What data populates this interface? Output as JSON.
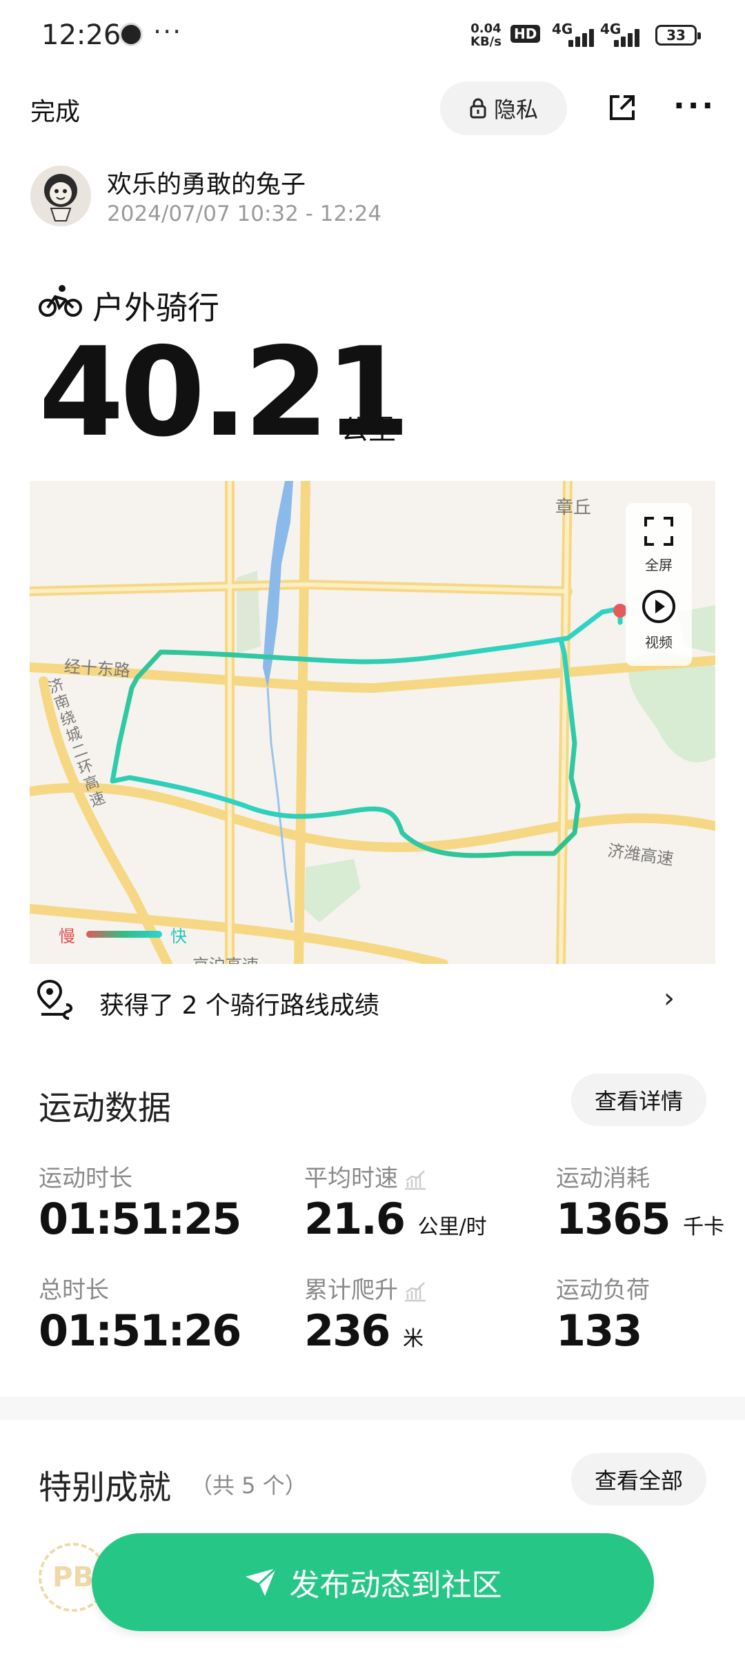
{
  "status_bar": {
    "time": "12:26",
    "more": "···",
    "net_speed_value": "0.04",
    "net_speed_unit": "KB/s",
    "hd": "HD",
    "sim1": "4G",
    "sim2": "4G",
    "battery": "33"
  },
  "header": {
    "done_label": "完成",
    "privacy_label": "隐私",
    "share_icon": "share-icon",
    "more_icon": "more-icon"
  },
  "user": {
    "name": "欢乐的勇敢的兔子",
    "date_range": "2024/07/07 10:32 - 12:24"
  },
  "activity": {
    "type": "户外骑行",
    "distance": "40.21",
    "distance_unit": "公里"
  },
  "map": {
    "labels": {
      "zhangqiu": "章丘",
      "jingshi_east": "经十东路",
      "ring_expressway": "济南绕城二环高速",
      "jiwei_expressway": "济潍高速",
      "jinghu_expressway": "京沪高速"
    },
    "fullscreen_label": "全屏",
    "video_label": "视频",
    "legend_slow": "慢",
    "legend_fast": "快",
    "achievement_text": "获得了 2 个骑行路线成绩"
  },
  "stats": {
    "title": "运动数据",
    "details_button": "查看详情",
    "items": [
      {
        "label": "运动时长",
        "value": "01:51:25",
        "unit": ""
      },
      {
        "label": "平均时速",
        "value": "21.6",
        "unit": "公里/时"
      },
      {
        "label": "运动消耗",
        "value": "1365",
        "unit": "千卡"
      },
      {
        "label": "总时长",
        "value": "01:51:26",
        "unit": ""
      },
      {
        "label": "累计爬升",
        "value": "236",
        "unit": "米"
      },
      {
        "label": "运动负荷",
        "value": "133",
        "unit": ""
      }
    ]
  },
  "achievements": {
    "title": "特别成就",
    "count_text": "（共 5 个）",
    "view_all_button": "查看全部",
    "pb_badge": "PB"
  },
  "publish_button": "发布动态到社区",
  "colors": {
    "accent_green": "#26c686",
    "route_green": "#2fbf85",
    "route_cyan": "#2ed3d4",
    "start_red": "#e85a5a"
  }
}
